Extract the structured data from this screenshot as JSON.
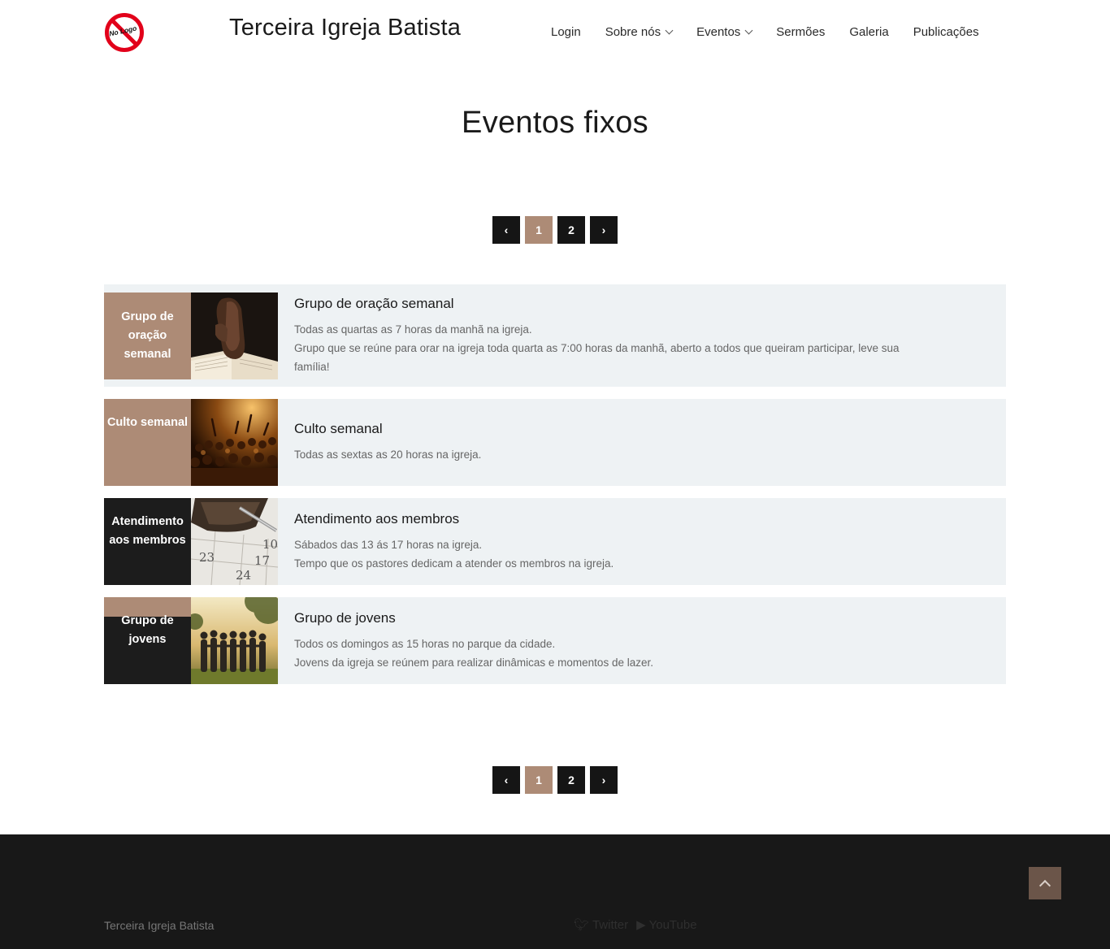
{
  "header": {
    "logo_text": "No Logo",
    "site_title": "Terceira Igreja Batista",
    "nav": [
      {
        "label": "Login"
      },
      {
        "label": "Sobre nós"
      },
      {
        "label": "Eventos"
      },
      {
        "label": "Sermões"
      },
      {
        "label": "Galeria"
      },
      {
        "label": "Publicações"
      }
    ]
  },
  "main": {
    "title": "Eventos fixos",
    "pagination": {
      "prev": "‹",
      "pages": [
        "1",
        "2"
      ],
      "next": "›",
      "current": "1"
    },
    "events": [
      {
        "label": "Grupo de oração semanal",
        "title": "Grupo de oração semanal",
        "lines": [
          "Todas as quartas as 7 horas da manhã na igreja.",
          "Grupo que se reúne para orar na igreja toda quarta as 7:00 horas da manhã, aberto a todos que queiram participar, leve sua",
          "família!"
        ],
        "image": "praying-hands-bible"
      },
      {
        "label": "Culto semanal",
        "title": "Culto semanal",
        "lines": [
          "Todas as sextas as 20 horas na igreja."
        ],
        "image": "worship-crowd"
      },
      {
        "label": "Atendimento aos membros",
        "title": "Atendimento aos membros",
        "lines": [
          "Sábados das 13 ás 17 horas na igreja.",
          "Tempo que os pastores dedicam a atender os membros na igreja."
        ],
        "image": "calendar-wallet-pen"
      },
      {
        "label": "Grupo de jovens",
        "title": "Grupo de jovens",
        "lines": [
          "Todos os domingos as 15 horas no parque da cidade.",
          "Jovens da igreja se reúnem para realizar dinâmicas e momentos de lazer."
        ],
        "image": "youth-group-park"
      }
    ]
  },
  "footer": {
    "title": "Terceira Igreja Batista",
    "social": [
      {
        "icon": "twitter-icon",
        "label": "Twitter"
      },
      {
        "icon": "youtube-icon",
        "label": "YouTube"
      }
    ]
  },
  "colors": {
    "accent": "#ad8b76",
    "dark": "#1c1c1c",
    "card_bg": "#eef2f4",
    "footer_bg": "#181818"
  }
}
